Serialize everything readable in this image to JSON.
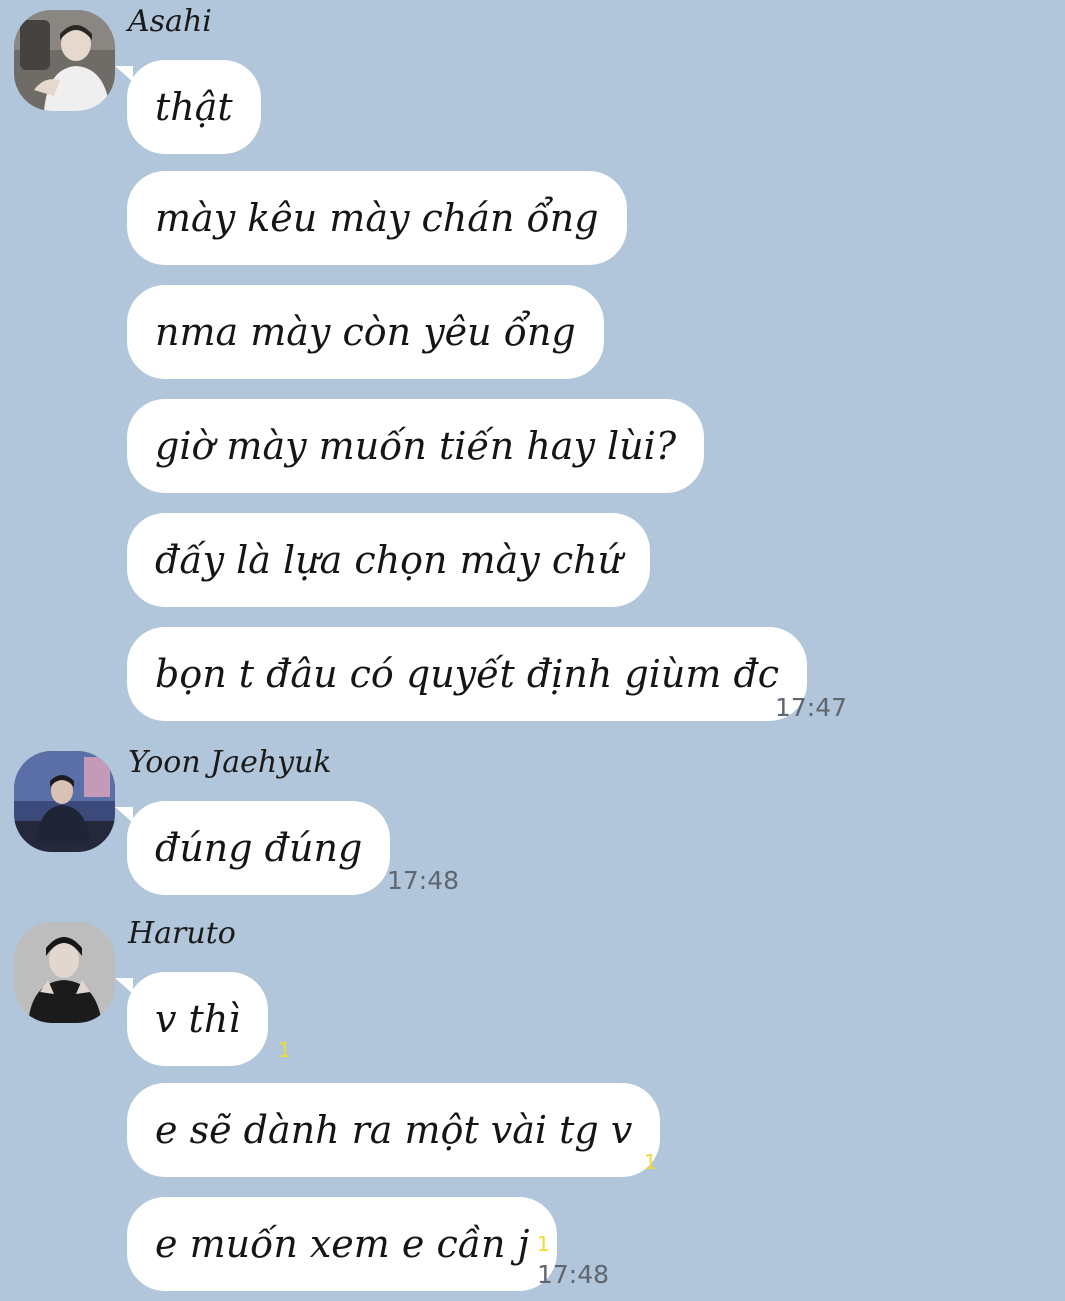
{
  "colors": {
    "background": "#b1c6da",
    "bubble": "#ffffff",
    "text": "#151515",
    "time": "#5f6670",
    "unread": "#f0dc2a"
  },
  "groups": [
    {
      "sender": "Asahi",
      "avatar_icon": "profile-photo-asahi",
      "messages": [
        "thật",
        "mày kêu mày chán ổng",
        "nma mày còn yêu ổng",
        "giờ mày muốn tiến hay lùi?",
        "đấy là lựa chọn mày chứ",
        "bọn t đâu có quyết định giùm đc"
      ],
      "time": "17:47"
    },
    {
      "sender": "Yoon Jaehyuk",
      "avatar_icon": "profile-photo-yoon-jaehyuk",
      "messages": [
        "đúng đúng"
      ],
      "time": "17:48"
    },
    {
      "sender": "Haruto",
      "avatar_icon": "profile-photo-haruto",
      "messages": [
        "v thì",
        "e sẽ dành ra một vài tg v",
        "e muốn xem e cần j"
      ],
      "unread_counts": [
        "1",
        "1",
        "1"
      ],
      "time": "17:48"
    }
  ]
}
